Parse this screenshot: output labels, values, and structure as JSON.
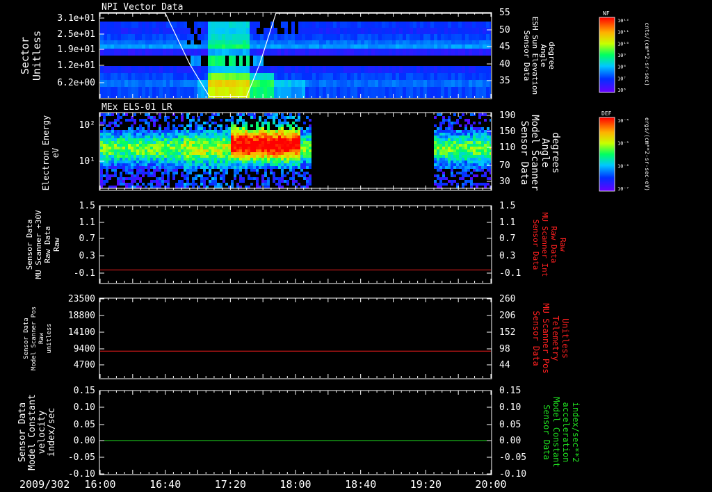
{
  "figure": {
    "date_label": "2009/302",
    "time_ticks": [
      "16:00",
      "16:40",
      "17:20",
      "18:00",
      "18:40",
      "19:20",
      "20:00"
    ],
    "colors": {
      "background": "#000000",
      "axes": "#ffffff",
      "red_trace": "#ff2020",
      "green_trace": "#20e020"
    }
  },
  "panels": [
    {
      "title": "NPI Vector Data",
      "left_label": [
        "Sector",
        "Unitless"
      ],
      "left_ticks": [
        "3.1e+01",
        "2.5e+01",
        "1.9e+01",
        "1.2e+01",
        "6.2e+00"
      ],
      "right_label": [
        "Sensor Data",
        "ESH Sun Elevation",
        "Angle",
        "degree"
      ],
      "right_ticks": [
        "55",
        "50",
        "45",
        "40",
        "35"
      ],
      "colorbar_title": "NF",
      "colorbar_label": "cnts/(cm**2-sr-sec)",
      "colorbar_ticks": [
        "10¹²",
        "10¹¹",
        "10¹⁰",
        "10⁹",
        "10⁸",
        "10⁷",
        "10⁶"
      ]
    },
    {
      "title": "MEx ELS-01 LR",
      "left_label": [
        "Electron Energy",
        "eV"
      ],
      "left_ticks": [
        "10²",
        "10¹"
      ],
      "right_label": [
        "Sensor Data",
        "Model Scanner",
        "Angle",
        "degrees"
      ],
      "right_ticks": [
        "190",
        "150",
        "110",
        "70",
        "30"
      ],
      "colorbar_title": "DEF",
      "colorbar_label": "ergs/(cm**2-sr-sec-eV)",
      "colorbar_ticks": [
        "10⁻⁴",
        "10⁻⁵",
        "10⁻⁶",
        "10⁻⁷"
      ]
    },
    {
      "left_label": [
        "Sensor Data",
        "MU Scanner +30V",
        "Raw Data",
        "Raw"
      ],
      "left_ticks": [
        "1.5",
        "1.1",
        "0.7",
        "0.3",
        "-0.1"
      ],
      "right_label": [
        "Sensor Data",
        "MU Scanner Int",
        "Raw Data",
        "Raw"
      ],
      "right_ticks": [
        "1.5",
        "1.1",
        "0.7",
        "0.3",
        "-0.1"
      ]
    },
    {
      "left_label": [
        "Sensor Data",
        "Model Scanner Pos",
        "Raw",
        "unitless"
      ],
      "left_ticks": [
        "23500",
        "18800",
        "14100",
        "9400",
        "4700"
      ],
      "right_label": [
        "Sensor Data",
        "MU Scanner Pos",
        "Telemetry",
        "Unitless"
      ],
      "right_ticks": [
        "260",
        "206",
        "152",
        "98",
        "44"
      ]
    },
    {
      "left_label": [
        "Sensor Data",
        "Model Constant",
        "velocity",
        "index/sec"
      ],
      "left_ticks": [
        "0.15",
        "0.10",
        "0.05",
        "0.00",
        "-0.05",
        "-0.10"
      ],
      "right_label": [
        "Sensor Data",
        "Model Constant",
        "acceleration",
        "index/sec**2"
      ],
      "right_ticks": [
        "0.15",
        "0.10",
        "0.05",
        "0.00",
        "-0.05",
        "-0.10"
      ]
    }
  ],
  "chart_data": [
    {
      "type": "heatmap",
      "title": "NPI Vector Data",
      "ylabel": "Sector Unitless",
      "y2label": "Sensor Data ESH Sun Elevation Angle degree",
      "ylim": [
        0,
        31
      ],
      "y2lim": [
        30,
        55
      ],
      "xlim": [
        "16:00",
        "20:00"
      ],
      "overlay_line": {
        "name": "",
        "x": [
          "16:00",
          "16:40",
          "16:55",
          "17:07",
          "17:20",
          "17:30",
          "17:38",
          "17:48",
          "20:00"
        ],
        "y": [
          55,
          55,
          40,
          30.5,
          30.5,
          30.5,
          40,
          55,
          55
        ]
      }
    },
    {
      "type": "heatmap",
      "title": "MEx ELS-01 LR",
      "ylabel": "Electron Energy eV",
      "y2label": "Sensor Data Model Scanner Angle degrees",
      "yscale": "log",
      "ylim": [
        1,
        200
      ],
      "y2lim": [
        10,
        190
      ],
      "xlim": [
        "16:00",
        "20:00"
      ],
      "data_gaps": [
        [
          "18:09",
          "19:24"
        ]
      ]
    },
    {
      "type": "line",
      "ylabel": "Sensor Data MU Scanner +30V Raw Data Raw",
      "y2label": "Sensor Data MU Scanner Int Raw Data Raw",
      "ylim": [
        -0.3,
        1.5
      ],
      "series": [
        {
          "x": [
            "16:00",
            "20:00"
          ],
          "values": [
            0.0,
            0.0
          ],
          "color": "#ff2020"
        }
      ]
    },
    {
      "type": "line",
      "ylabel": "Sensor Data Model Scanner Pos Raw unitless",
      "y2label": "Sensor Data MU Scanner Pos Telemetry Unitless",
      "ylim": [
        0,
        23500
      ],
      "y2lim": [
        10,
        260
      ],
      "series": [
        {
          "x": [
            "16:00",
            "20:00"
          ],
          "values": [
            8000,
            8000
          ],
          "color": "#ff2020"
        }
      ]
    },
    {
      "type": "line",
      "ylabel": "Sensor Data Model Constant velocity index/sec",
      "y2label": "Sensor Data Model Constant acceleration index/sec**2",
      "ylim": [
        -0.1,
        0.15
      ],
      "series": [
        {
          "x": [
            "16:00",
            "20:00"
          ],
          "values": [
            0.0,
            0.0
          ],
          "color": "#20e020"
        }
      ]
    }
  ]
}
